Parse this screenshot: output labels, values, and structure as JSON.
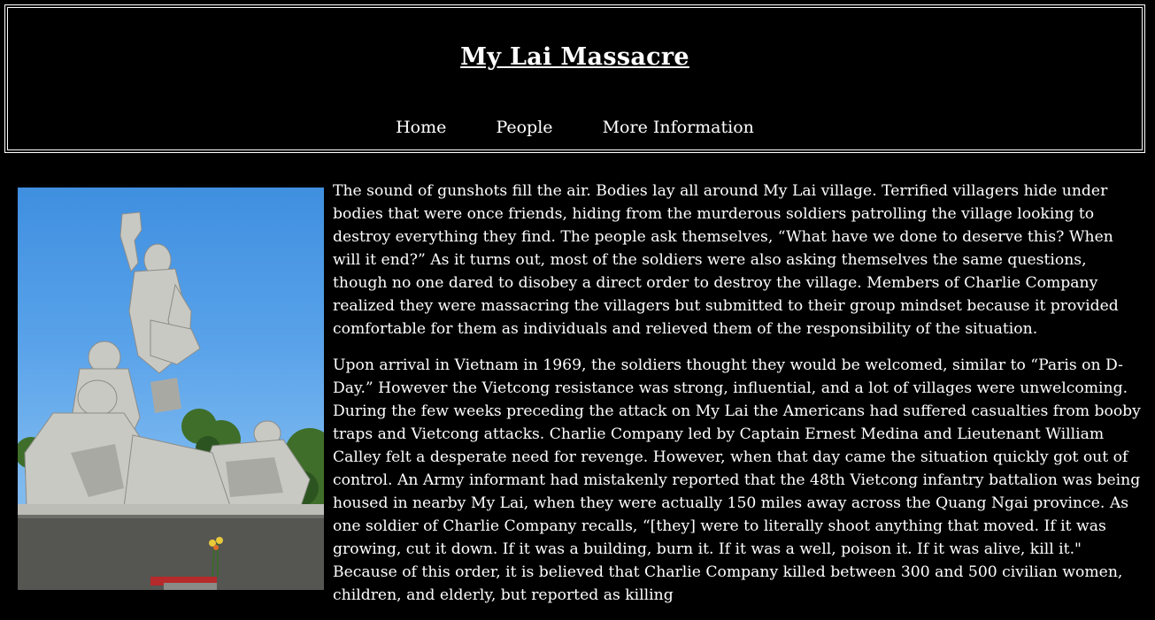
{
  "header": {
    "title": "My Lai Massacre",
    "nav": [
      "Home",
      "People",
      "More Information"
    ]
  },
  "image": {
    "icon": "memorial-statue-photo"
  },
  "article": {
    "paragraphs": [
      "The sound of gunshots fill the air. Bodies lay all around My Lai village. Terrified villagers hide under bodies that were once friends, hiding from the murderous soldiers patrolling the village looking to destroy everything they find. The people ask themselves, “What have we done to deserve this? When will it end?” As it turns out, most of the soldiers were also asking themselves the same questions, though no one dared to disobey a direct order to destroy the village. Members of Charlie Company realized they were massacring the villagers but submitted to their group mindset because it provided comfortable for them as individuals and relieved them of the responsibility of the situation.",
      "Upon arrival in Vietnam in 1969, the soldiers thought they would be welcomed, similar to “Paris on D-Day.” However the Vietcong resistance was strong, influential, and a lot of villages were unwelcoming. During the few weeks preceding the attack on My Lai the Americans had suffered casualties from booby traps and Vietcong attacks. Charlie Company led by Captain Ernest Medina and Lieutenant William Calley felt a desperate need for revenge. However, when that day came the situation quickly got out of control. An Army informant had mistakenly reported that the 48th Vietcong infantry battalion was being housed in nearby My Lai, when they were actually 150 miles away across the Quang Ngai province. As one soldier of Charlie Company recalls, “[they] were to literally shoot anything that moved. If it was growing, cut it down. If it was a building, burn it. If it was a well, poison it. If it was alive, kill it.\" Because of this order, it is believed that Charlie Company killed between 300 and 500 civilian women, children, and elderly, but reported as killing"
    ]
  }
}
